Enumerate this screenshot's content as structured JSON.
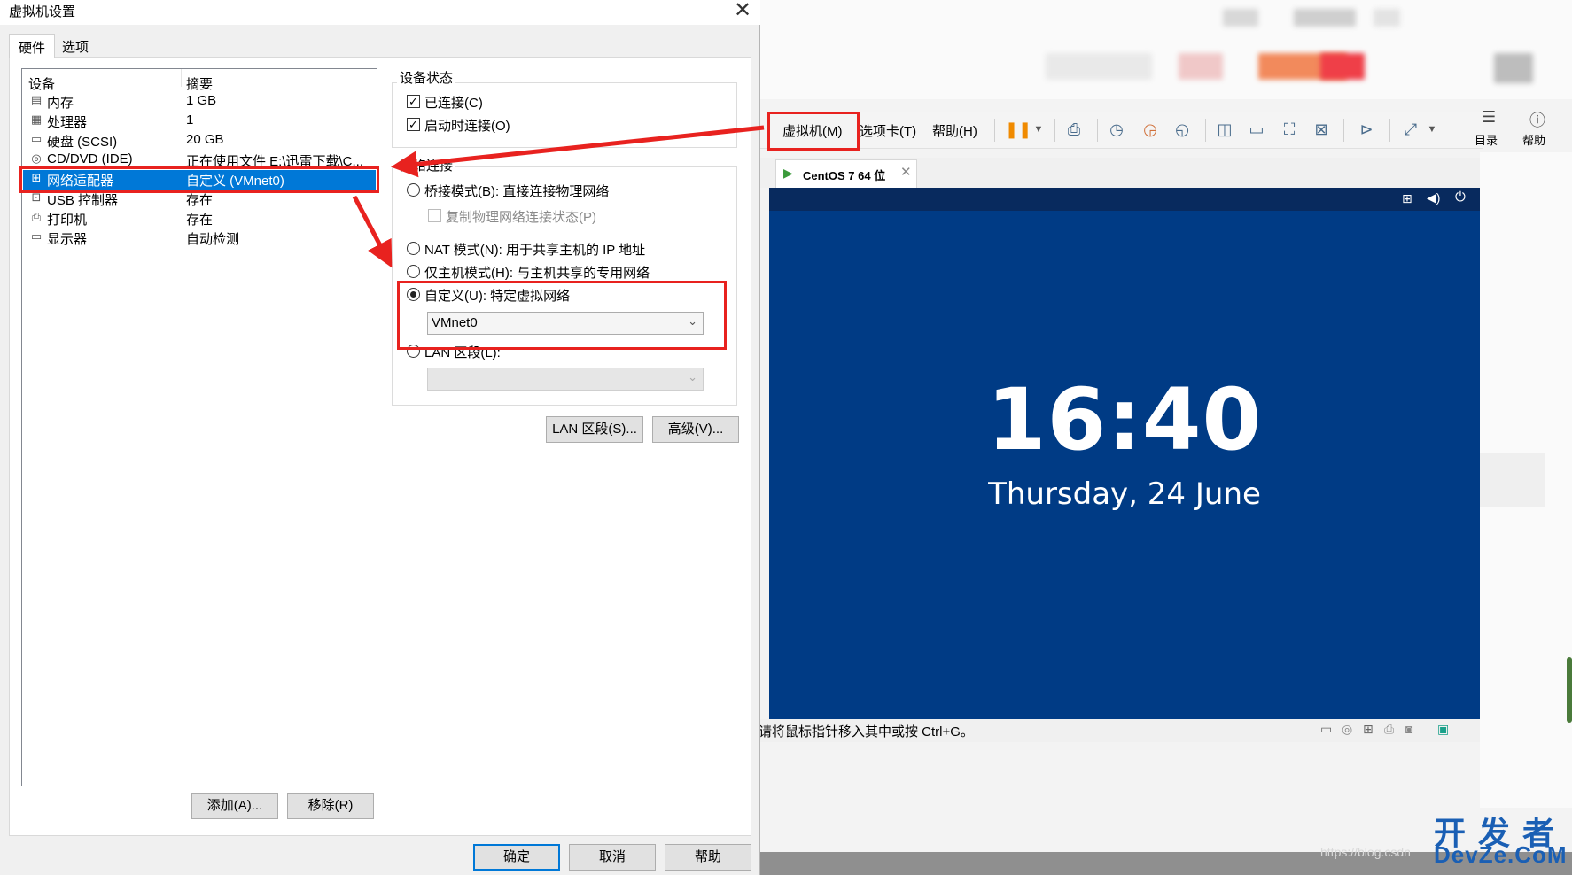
{
  "dialog": {
    "title": "虚拟机设置",
    "tabs": [
      "硬件",
      "选项"
    ],
    "columns": {
      "device": "设备",
      "summary": "摘要"
    },
    "devices": [
      {
        "name": "内存",
        "summary": "1 GB",
        "icon": "memory-icon"
      },
      {
        "name": "处理器",
        "summary": "1",
        "icon": "cpu-icon"
      },
      {
        "name": "硬盘 (SCSI)",
        "summary": "20 GB",
        "icon": "hard-disk-icon"
      },
      {
        "name": "CD/DVD (IDE)",
        "summary": "正在使用文件 E:\\迅雷下载\\C...",
        "icon": "cd-dvd-icon"
      },
      {
        "name": "网络适配器",
        "summary": "自定义 (VMnet0)",
        "icon": "network-adapter-icon",
        "selected": true
      },
      {
        "name": "USB 控制器",
        "summary": "存在",
        "icon": "usb-icon"
      },
      {
        "name": "打印机",
        "summary": "存在",
        "icon": "printer-icon"
      },
      {
        "name": "显示器",
        "summary": "自动检测",
        "icon": "monitor-icon"
      }
    ],
    "add_button": "添加(A)...",
    "remove_button": "移除(R)",
    "device_status": {
      "title": "设备状态",
      "connected": "已连接(C)",
      "connect_on_power_on": "启动时连接(O)"
    },
    "network": {
      "title": "网络连接",
      "bridged": "桥接模式(B): 直接连接物理网络",
      "replicate": "复制物理网络连接状态(P)",
      "nat": "NAT 模式(N): 用于共享主机的 IP 地址",
      "host_only": "仅主机模式(H): 与主机共享的专用网络",
      "custom": "自定义(U): 特定虚拟网络",
      "custom_value": "VMnet0",
      "lan_segment": "LAN 区段(L):",
      "lan_segment_value": ""
    },
    "lan_segments_button": "LAN 区段(S)...",
    "advanced_button": "高级(V)...",
    "ok_button": "确定",
    "cancel_button": "取消",
    "help_button": "帮助"
  },
  "vmware": {
    "menus": [
      "虚拟机(M)",
      "选项卡(T)",
      "帮助(H)"
    ],
    "right_tools": [
      "目录",
      "帮助"
    ],
    "vm_tab": "CentOS 7 64 位",
    "clock": "16:40",
    "date": "Thursday, 24 June",
    "status": "请将鼠标指针移入其中或按 Ctrl+G。"
  },
  "watermark": {
    "line1": "开发者",
    "line2": "DevZe.CoM",
    "url": "https://blog.csdn"
  },
  "colors": {
    "selection": "#0078d7",
    "annotation": "#e8221f",
    "vm_background": "#003b85"
  }
}
